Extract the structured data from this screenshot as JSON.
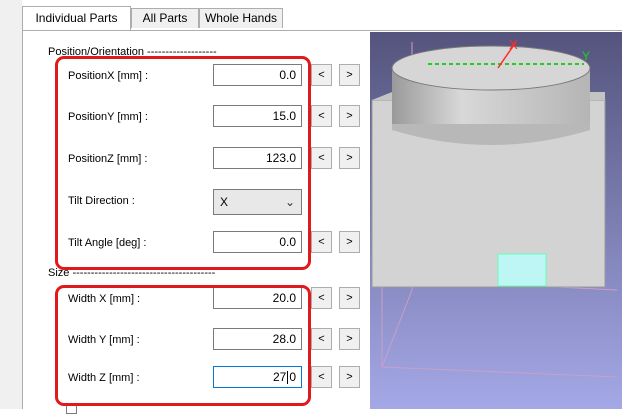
{
  "tabs": [
    {
      "label": "Individual Parts",
      "active": true
    },
    {
      "label": "All Parts",
      "active": false
    },
    {
      "label": "Whole Hands",
      "active": false
    }
  ],
  "position_group": {
    "label": "Position/Orientation -------------------",
    "fields": [
      {
        "label": "PositionX [mm] :",
        "value": "0.0"
      },
      {
        "label": "PositionY [mm] :",
        "value": "15.0"
      },
      {
        "label": "PositionZ [mm] :",
        "value": "123.0"
      }
    ],
    "tilt_direction": {
      "label": "Tilt Direction :",
      "value": "X"
    },
    "tilt_angle": {
      "label": "Tilt Angle [deg] :",
      "value": "0.0"
    }
  },
  "size_group": {
    "label": "Size ---------------------------------------",
    "fields": [
      {
        "label": "Width X [mm] :",
        "value": "20.0"
      },
      {
        "label": "Width Y [mm] :",
        "value": "28.0"
      },
      {
        "label": "Width Z [mm] :",
        "value_before_caret": "27",
        "value_after_caret": "0"
      }
    ]
  },
  "stepper": {
    "decrement": "<",
    "increment": ">"
  },
  "viewport": {
    "axis_x_label": "X",
    "axis_y_label": "Y",
    "colors": {
      "background_top": "#54547d",
      "background_bottom": "#a4a8e6",
      "axis_x": "#ff2a2a",
      "axis_y": "#1bd41b",
      "part_face": "#d3d3d3",
      "fingertip": "#bdf6f4",
      "bounding_box": "#c8a0c8"
    }
  },
  "highlight_color": "#e0191a"
}
